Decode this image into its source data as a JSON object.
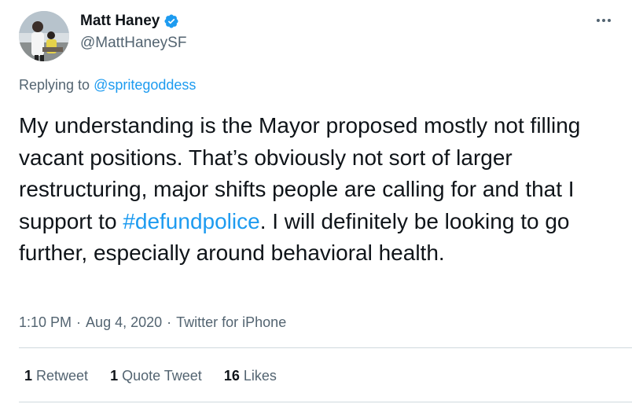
{
  "author": {
    "name": "Matt Haney",
    "handle": "@MattHaneySF",
    "verified_color": "#1d9bf0"
  },
  "reply": {
    "prefix": "Replying to ",
    "mention": "@spritegoddess"
  },
  "tweet": {
    "text_before": "My understanding is the Mayor proposed mostly not filling vacant positions. That’s obviously not sort of larger restructuring, major shifts people are calling for and that I support to ",
    "hashtag": "#defundpolice",
    "text_after": ". I will definitely be looking to go further, especially around behavioral health."
  },
  "meta": {
    "time": "1:10 PM",
    "sep1": "·",
    "date": "Aug 4, 2020",
    "sep2": "·",
    "source": "Twitter for iPhone"
  },
  "stats": {
    "retweets_count": "1",
    "retweets_label": "Retweet",
    "quotes_count": "1",
    "quotes_label": "Quote Tweet",
    "likes_count": "16",
    "likes_label": "Likes"
  },
  "colors": {
    "link": "#1d9bf0",
    "secondary_text": "#536471",
    "primary_text": "#0f1419"
  },
  "icons": [
    "avatar-photo",
    "verified-badge-icon",
    "more-options-icon"
  ]
}
